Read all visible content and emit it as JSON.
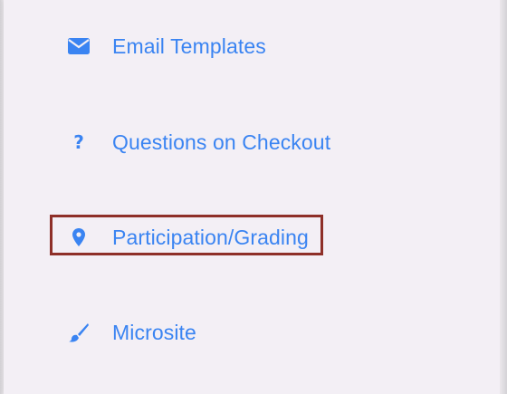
{
  "menu": {
    "items": [
      {
        "label": "Email Templates",
        "icon": "envelope-icon"
      },
      {
        "label": "Questions on Checkout",
        "icon": "question-mark-icon"
      },
      {
        "label": "Participation/Grading",
        "icon": "map-pin-icon",
        "highlighted": true
      },
      {
        "label": "Microsite",
        "icon": "paint-brush-icon"
      }
    ]
  },
  "colors": {
    "link": "#3a84f2",
    "highlight_border": "#8e2f28",
    "panel_background": "#f3eff5"
  }
}
